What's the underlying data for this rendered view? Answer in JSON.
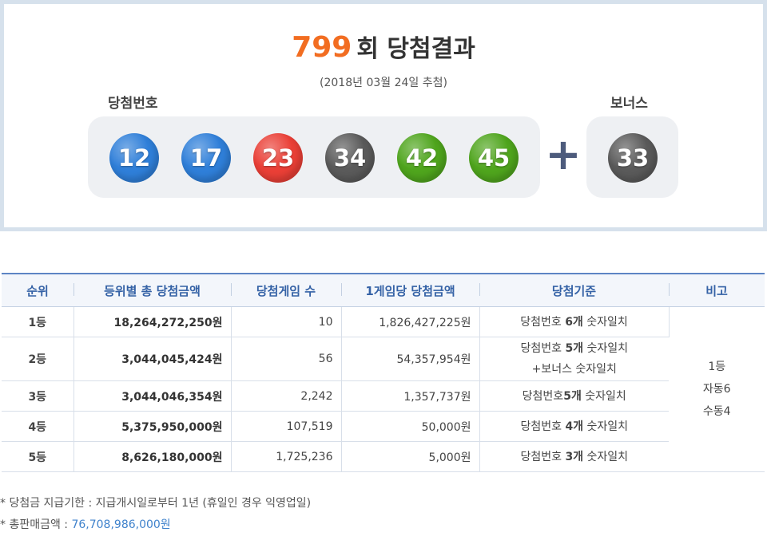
{
  "header": {
    "round_number": "799",
    "title_suffix": "회 당첨결과",
    "draw_date": "(2018년 03월 24일 추첨)",
    "winning_label": "당첨번호",
    "bonus_label": "보너스",
    "plus_sign": "+"
  },
  "balls": [
    {
      "number": "12",
      "color": "#2f7fd9"
    },
    {
      "number": "17",
      "color": "#2f7fd9"
    },
    {
      "number": "23",
      "color": "#ea3f36"
    },
    {
      "number": "34",
      "color": "#5a5a5a"
    },
    {
      "number": "42",
      "color": "#4fa51d"
    },
    {
      "number": "45",
      "color": "#4fa51d"
    }
  ],
  "bonus_ball": {
    "number": "33",
    "color": "#5a5a5a"
  },
  "table": {
    "headers": [
      "순위",
      "등위별 총 당첨금액",
      "당첨게임 수",
      "1게임당 당첨금액",
      "당첨기준",
      "비고"
    ],
    "rows": [
      {
        "rank": "1등",
        "total": "18,264,272,250원",
        "games": "10",
        "per_game": "1,826,427,225원",
        "criteria_pre": "당첨번호 ",
        "criteria_bold": "6개",
        "criteria_post": " 숫자일치",
        "criteria_line2": ""
      },
      {
        "rank": "2등",
        "total": "3,044,045,424원",
        "games": "56",
        "per_game": "54,357,954원",
        "criteria_pre": "당첨번호 ",
        "criteria_bold": "5개",
        "criteria_post": " 숫자일치",
        "criteria_line2": "+보너스 숫자일치"
      },
      {
        "rank": "3등",
        "total": "3,044,046,354원",
        "games": "2,242",
        "per_game": "1,357,737원",
        "criteria_pre": "당첨번호",
        "criteria_bold": "5개",
        "criteria_post": " 숫자일치",
        "criteria_line2": ""
      },
      {
        "rank": "4등",
        "total": "5,375,950,000원",
        "games": "107,519",
        "per_game": "50,000원",
        "criteria_pre": "당첨번호 ",
        "criteria_bold": "4개",
        "criteria_post": " 숫자일치",
        "criteria_line2": ""
      },
      {
        "rank": "5등",
        "total": "8,626,180,000원",
        "games": "1,725,236",
        "per_game": "5,000원",
        "criteria_pre": "당첨번호 ",
        "criteria_bold": "3개",
        "criteria_post": " 숫자일치",
        "criteria_line2": ""
      }
    ],
    "note": {
      "line1": "1등",
      "line2": "자동6",
      "line3": "수동4"
    }
  },
  "footnotes": {
    "payment_deadline": "* 당첨금 지급기한 : 지급개시일로부터 1년 (휴일인 경우 익영업일)",
    "sales_label": "* 총판매금액 : ",
    "sales_amount": "76,708,986,000원"
  },
  "colors": {
    "accent_orange": "#f26d21",
    "header_blue": "#3562a6",
    "amount_blue": "#3f82cc"
  }
}
